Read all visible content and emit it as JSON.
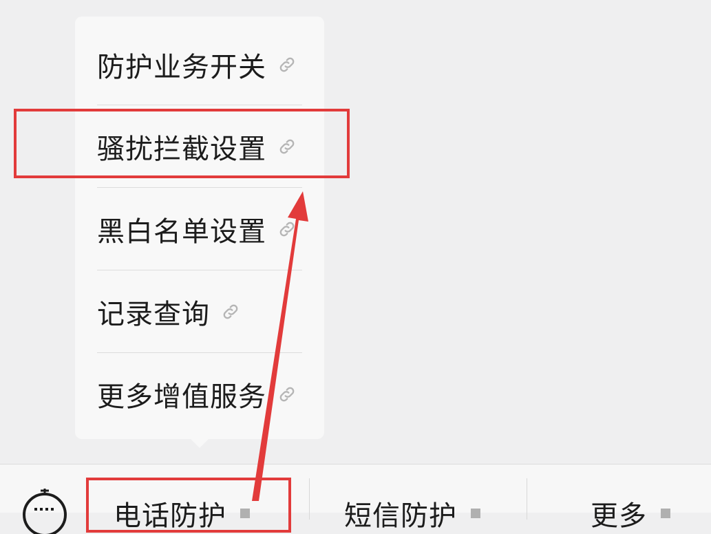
{
  "menu": {
    "items": [
      {
        "label": "防护业务开关",
        "icon": "link-icon"
      },
      {
        "label": "骚扰拦截设置",
        "icon": "link-icon"
      },
      {
        "label": "黑白名单设置",
        "icon": "link-icon"
      },
      {
        "label": "记录查询",
        "icon": "link-icon"
      },
      {
        "label": "更多增值服务",
        "icon": "link-icon"
      }
    ]
  },
  "tabbar": {
    "keyboard_icon": "keyboard-icon",
    "tabs": [
      {
        "label": "电话防护",
        "icon": "caret-icon"
      },
      {
        "label": "短信防护",
        "icon": "caret-icon"
      },
      {
        "label": "更多",
        "icon": "caret-icon"
      }
    ]
  },
  "colors": {
    "annotation": "#e23b3b",
    "background": "#efeff0",
    "menu_bg": "#f8f8f8"
  }
}
